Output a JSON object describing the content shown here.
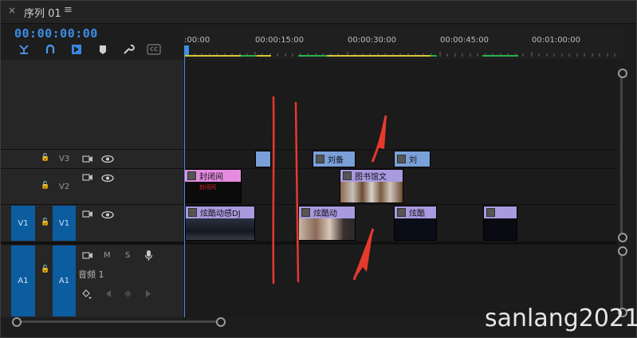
{
  "header": {
    "close": "×",
    "title": "序列 01",
    "menu": "≡"
  },
  "timecode": "00:00:00:00",
  "tools": [
    "snap-icon",
    "link-icon",
    "marker-add-icon",
    "marker-icon",
    "wrench-icon",
    "captions-icon"
  ],
  "tools_cc": "CC",
  "ruler": {
    "labels": [
      ":00:00",
      "00:00:15:00",
      "00:00:30:00",
      "00:00:45:00",
      "00:01:00:00"
    ]
  },
  "tracks": {
    "v3": {
      "label": "V3"
    },
    "v2": {
      "label": "V2"
    },
    "v1": {
      "label": "V1",
      "source": "V1"
    },
    "a1": {
      "label": "A1",
      "source": "A1",
      "name": "音频 1",
      "m": "M",
      "s": "S"
    }
  },
  "clips": {
    "v3_2": "刘备",
    "v3_3": "刘",
    "v2_1": "封闭间",
    "v2_1_sub": "封闭间",
    "v2_2": "图书馆文",
    "v1_1": "炫酷动感DJ",
    "v1_2": "炫酷动",
    "v1_3": "炫酷"
  },
  "colors": {
    "accent": "#3b8fe6",
    "annotation": "#e53a2d"
  },
  "watermark": "sanlang2021"
}
